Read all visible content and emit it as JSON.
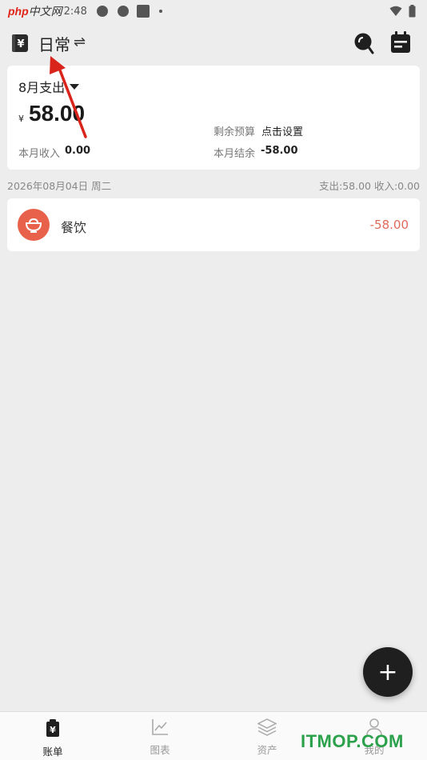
{
  "status_bar": {
    "watermark_php": "php",
    "watermark_cn": "中文网",
    "time": "2:48"
  },
  "header": {
    "ledger_name": "日常",
    "switch_glyph": "⇌",
    "icons": [
      "yen-book-icon",
      "search-icon",
      "calendar-icon"
    ]
  },
  "summary": {
    "month_label": "8月支出",
    "currency": "¥",
    "expense_amount": "58.00",
    "budget_label": "剩余预算",
    "budget_action": "点击设置",
    "income_label": "本月收入",
    "income_value": "0.00",
    "balance_label": "本月结余",
    "balance_value": "-58.00"
  },
  "day_group": {
    "date": "2026年08月04日 周二",
    "summary": "支出:58.00  收入:0.00"
  },
  "transactions": [
    {
      "category": "餐饮",
      "amount": "-58.00",
      "icon": "bowl-icon"
    }
  ],
  "fab": {
    "glyph": "+"
  },
  "bottom_nav": [
    {
      "label": "账单",
      "icon": "bill-icon",
      "active": true
    },
    {
      "label": "图表",
      "icon": "chart-icon",
      "active": false
    },
    {
      "label": "资产",
      "icon": "layers-icon",
      "active": false
    },
    {
      "label": "我的",
      "icon": "person-icon",
      "active": false
    }
  ],
  "watermark_bottom": "ITMOP.COM",
  "colors": {
    "background": "#ededed",
    "expense_red": "#e06a5a",
    "category_bg": "#e8614a",
    "fab_bg": "#1f1f1f",
    "annotation_arrow": "#d9241b",
    "watermark_green": "#2ba14b"
  }
}
